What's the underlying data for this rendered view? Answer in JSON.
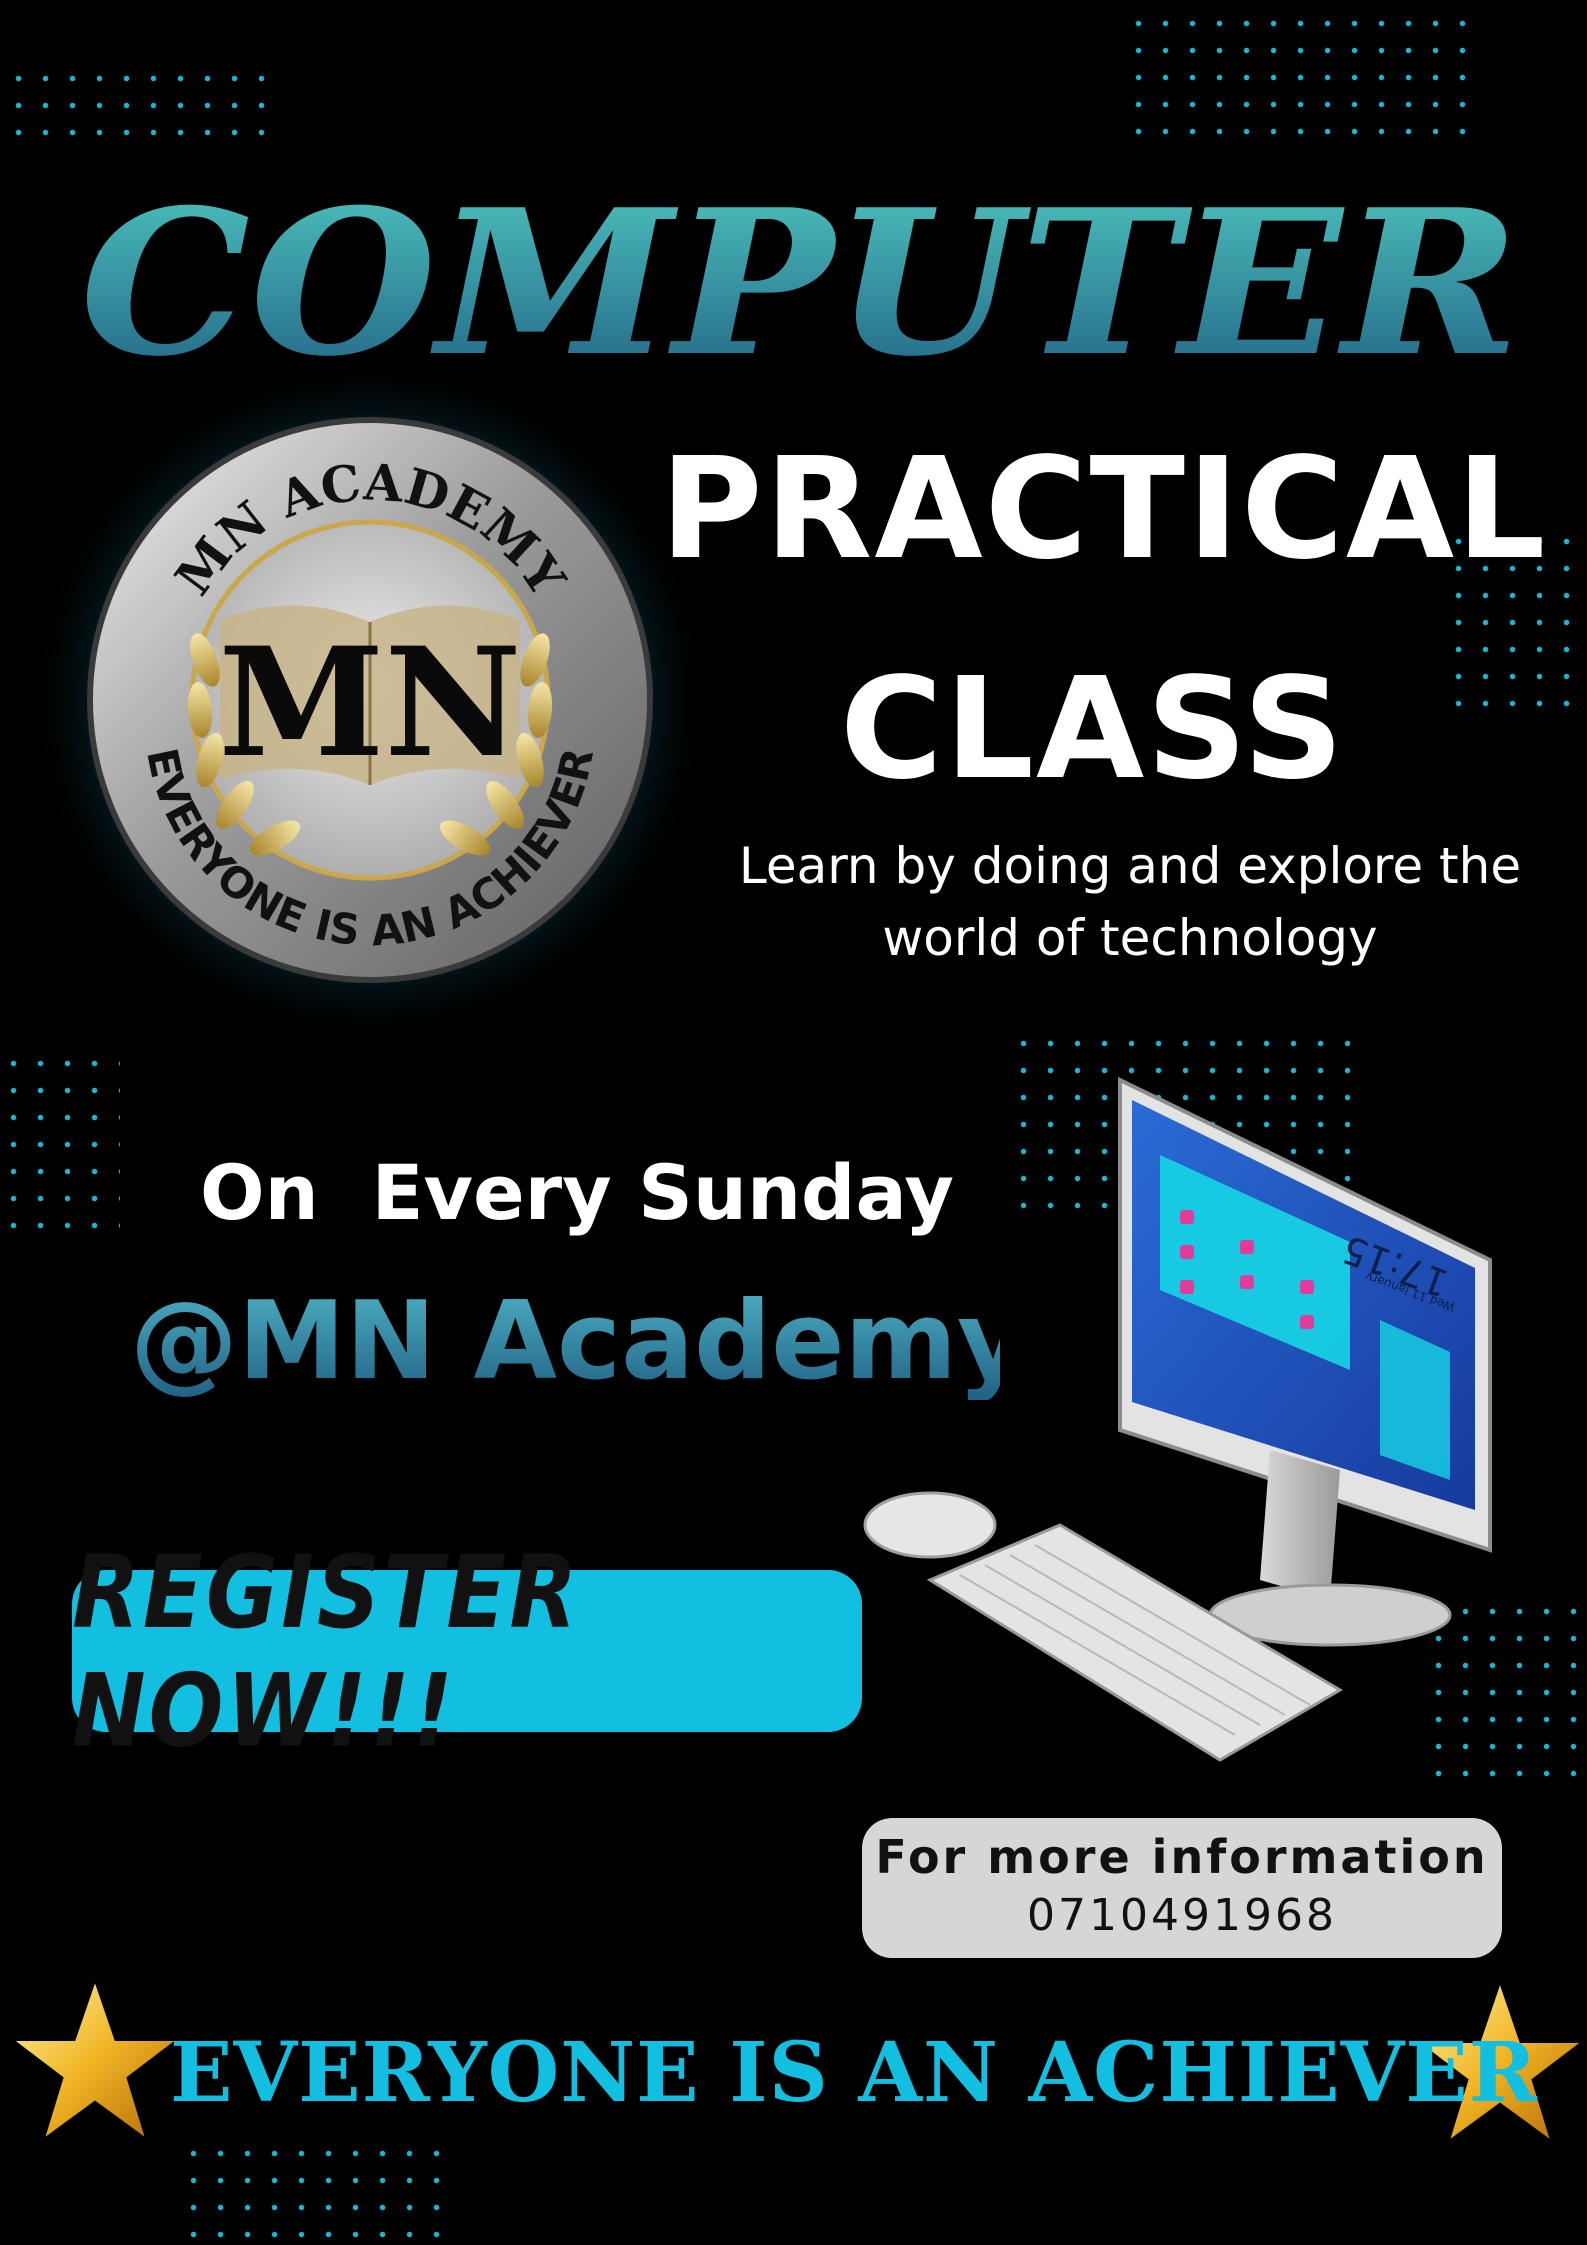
{
  "colors": {
    "background": "#000000",
    "accent_cyan": "#12bfe0",
    "title_gradient_top": "#4fc8c0",
    "title_gradient_bottom": "#1f5e82",
    "text_white": "#ffffff",
    "info_box": "#d6d6d6"
  },
  "poster": {
    "title": "COMPUTER",
    "subtitle_line1": "PRACTICAL",
    "subtitle_line2": "CLASS",
    "tagline_line1": "Learn by doing and explore the",
    "tagline_line2": "world of technology",
    "schedule": "On  Every Sunday",
    "venue": "@MN Academy",
    "register_button": "REGISTER NOW!!!",
    "info_label": "For more information",
    "info_phone": "0710491968",
    "motto": "EVERYONE IS AN ACHIEVER"
  },
  "logo": {
    "top_arc": "MN ACADEMY",
    "monogram": "MN",
    "bottom_arc": "EVERYONE IS AN ACHIEVER"
  },
  "illustration": {
    "clock_time": "17:15",
    "clock_date": "Wed 11 January"
  },
  "icons": [
    "star-icon",
    "computer-illustration",
    "book-icon",
    "laurel-icon"
  ]
}
